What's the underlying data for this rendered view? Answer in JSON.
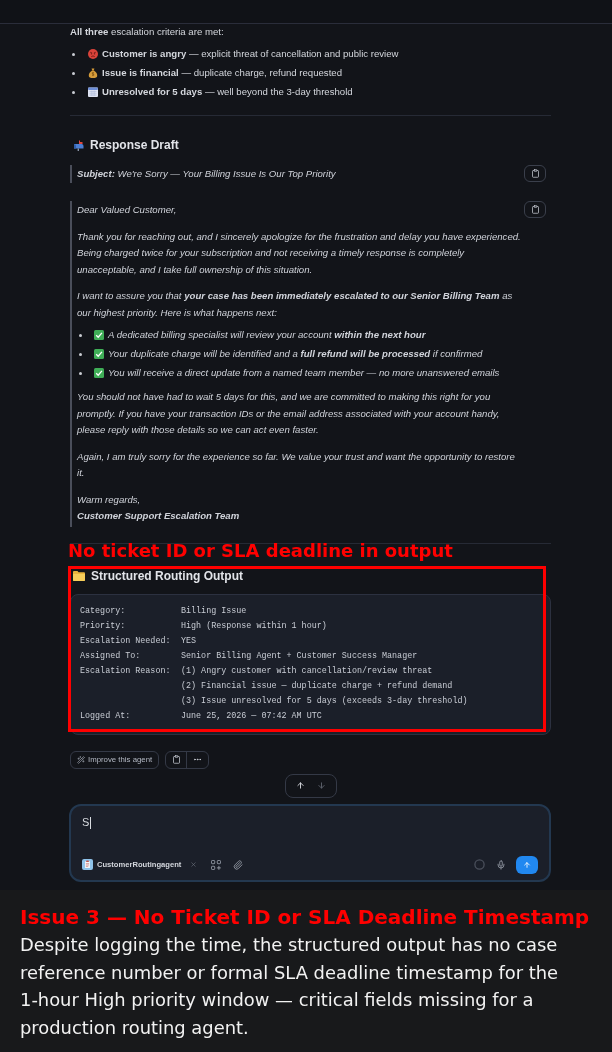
{
  "criteria": {
    "intro": "**All three** escalation criteria are met:",
    "items": [
      "**Customer is angry** — explicit threat of cancellation and public review",
      "**Issue is financial** — duplicate charge, refund requested",
      "**Unresolved for 5 days** — well beyond the 3-day threshold"
    ]
  },
  "response_draft": {
    "heading": "Response Draft",
    "subject": "**Subject:** We're Sorry — Your Billing Issue Is Our Top Priority",
    "letter": [
      {
        "kind": "paragraph",
        "text": "Dear Valued Customer,"
      },
      {
        "kind": "paragraph",
        "text": "Thank you for reaching out, and I sincerely apologize for the frustration and delay you have experienced. Being charged twice for your subscription and not receiving a timely response is completely unacceptable, and I take full ownership of this situation."
      },
      {
        "kind": "paragraph",
        "text": "I want to assure you that **your case has been immediately escalated to our Senior Billing Team** as our highest priority. Here is what happens next:"
      },
      {
        "kind": "checklist",
        "items": [
          "A dedicated billing specialist will review your account **within the next hour**",
          "Your duplicate charge will be identified and a **full refund will be processed** if confirmed",
          "You will receive a direct update from a named team member — no more unanswered emails"
        ]
      },
      {
        "kind": "paragraph",
        "text": "You should not have had to wait 5 days for this, and we are committed to making this right for you promptly. If you have your transaction IDs or the email address associated with your account handy, please reply with those details so we can act even faster."
      },
      {
        "kind": "paragraph",
        "text": "Again, I am truly sorry for the experience so far. We value your trust and want the opportunity to restore it."
      },
      {
        "kind": "signoff",
        "closing": "Warm regards,",
        "signature": "Customer Support Escalation Team"
      }
    ]
  },
  "annotation": {
    "label": "No ticket ID or SLA deadline in output"
  },
  "routing_output": {
    "heading": "Structured Routing Output",
    "rows": [
      {
        "label": "Category:",
        "values": [
          "Billing Issue"
        ]
      },
      {
        "label": "Priority:",
        "values": [
          "High (Response within 1 hour)"
        ]
      },
      {
        "label": "Escalation Needed:",
        "values": [
          "YES"
        ]
      },
      {
        "label": "Assigned To:",
        "values": [
          "Senior Billing Agent + Customer Success Manager"
        ]
      },
      {
        "label": "Escalation Reason:",
        "values": [
          "(1) Angry customer with cancellation/review threat",
          "(2) Financial issue — duplicate charge + refund demand",
          "(3) Issue unresolved for 5 days (exceeds 3-day threshold)"
        ]
      },
      {
        "label": "Logged At:",
        "values": [
          "June 25, 2026 — 07:42 AM UTC"
        ]
      }
    ]
  },
  "message_actions": {
    "improve_label": "Improve this agent"
  },
  "scroll_buttons": [
    {
      "kind": "up",
      "disabled": false
    },
    {
      "kind": "down",
      "disabled": true
    }
  ],
  "composer": {
    "value": "S",
    "agent_chip": "CustomerRoutingagent"
  },
  "caption": {
    "title": "Issue 3 — No Ticket ID or SLA Deadline Timestamp",
    "body": "Despite logging the time, the structured output has no case reference number or formal SLA deadline timestamp for the 1-hour High priority window — critical fields missing for a production routing agent."
  }
}
